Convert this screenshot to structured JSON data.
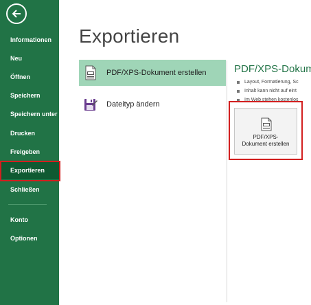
{
  "sidebar": {
    "back_icon": "back-arrow-icon",
    "items": [
      {
        "label": "Informationen"
      },
      {
        "label": "Neu"
      },
      {
        "label": "Öffnen"
      },
      {
        "label": "Speichern"
      },
      {
        "label": "Speichern unter"
      },
      {
        "label": "Drucken"
      },
      {
        "label": "Freigeben"
      },
      {
        "label": "Exportieren",
        "active": true
      },
      {
        "label": "Schließen"
      },
      {
        "label": "Konto"
      },
      {
        "label": "Optionen"
      }
    ]
  },
  "main": {
    "title": "Exportieren",
    "options": [
      {
        "label": "PDF/XPS-Dokument erstellen",
        "icon": "pdf-document-icon",
        "selected": true
      },
      {
        "label": "Dateityp ändern",
        "icon": "change-filetype-icon",
        "selected": false
      }
    ]
  },
  "detail": {
    "title": "PDF/XPS-Dokume",
    "bullets": [
      "Layout, Formatierung, Sc",
      "Inhalt kann nicht auf eint",
      "Im Web stehen kostenlos"
    ],
    "button": {
      "icon": "pdf-document-icon",
      "label_line1": "PDF/XPS-",
      "label_line2": "Dokument erstellen"
    }
  },
  "colors": {
    "sidebar_bg": "#217346",
    "sidebar_active": "#0f5a32",
    "selected_option": "#9fd5b7",
    "accent_title": "#217346",
    "highlight_frame": "#d21f1f"
  }
}
